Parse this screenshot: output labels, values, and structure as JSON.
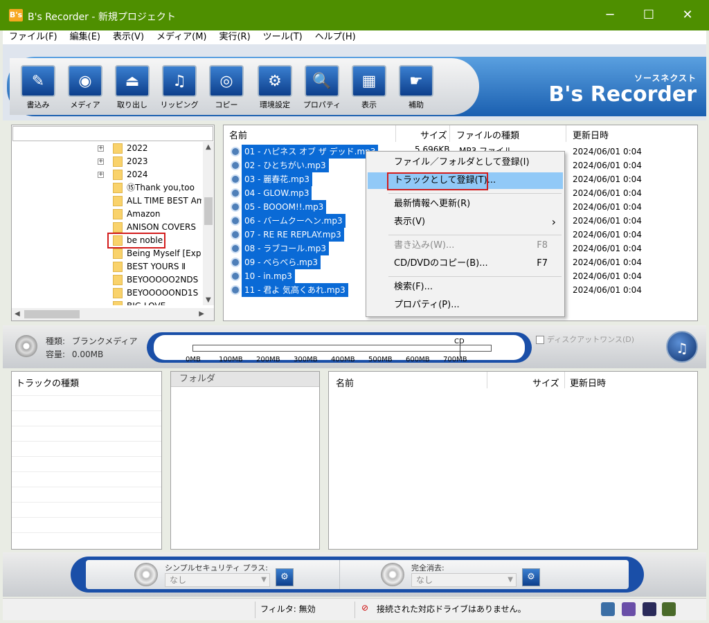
{
  "window": {
    "app_icon_text": "B's",
    "title": "B's Recorder - 新規プロジェクト",
    "minimize": "─",
    "maximize": "☐",
    "close": "✕"
  },
  "menu": [
    "ファイル(F)",
    "編集(E)",
    "表示(V)",
    "メディア(M)",
    "実行(R)",
    "ツール(T)",
    "ヘルプ(H)"
  ],
  "toolbar": {
    "buttons": [
      {
        "label": "書込み",
        "icon": "pencil-icon",
        "glyph": "✎"
      },
      {
        "label": "メディア",
        "icon": "disc-icon",
        "glyph": "◉"
      },
      {
        "label": "取り出し",
        "icon": "eject-icon",
        "glyph": "⏏"
      },
      {
        "label": "リッピング",
        "icon": "rip-icon",
        "glyph": "♫"
      },
      {
        "label": "コピー",
        "icon": "copy-disc-icon",
        "glyph": "◎"
      },
      {
        "label": "環境設定",
        "icon": "settings-icon",
        "glyph": "⚙"
      },
      {
        "label": "プロパティ",
        "icon": "properties-icon",
        "glyph": "🔍"
      },
      {
        "label": "表示",
        "icon": "view-icon",
        "glyph": "▦"
      },
      {
        "label": "補助",
        "icon": "hand-icon",
        "glyph": "☛"
      }
    ],
    "brand_sub": "ソースネクスト",
    "brand_name": "B's Recorder"
  },
  "tree": {
    "items": [
      {
        "label": "2022",
        "expander": "+"
      },
      {
        "label": "2023",
        "expander": "+"
      },
      {
        "label": "2024",
        "expander": "+"
      },
      {
        "label": "⑮Thank you,too",
        "expander": ""
      },
      {
        "label": "ALL TIME BEST Ambi",
        "expander": ""
      },
      {
        "label": "Amazon",
        "expander": ""
      },
      {
        "label": "ANISON COVERS",
        "expander": ""
      },
      {
        "label": "be noble",
        "expander": ""
      },
      {
        "label": "Being Myself [Exp",
        "expander": ""
      },
      {
        "label": "BEST YOURS Ⅱ",
        "expander": ""
      },
      {
        "label": "BEYOOOOO2NDS",
        "expander": ""
      },
      {
        "label": "BEYOOOOOND1S",
        "expander": ""
      },
      {
        "label": "BIG LOVE",
        "expander": ""
      }
    ]
  },
  "files": {
    "headers": {
      "name": "名前",
      "size": "サイズ",
      "type": "ファイルの種類",
      "date": "更新日時"
    },
    "first_size": "5,696KB",
    "first_type": "MP3 ファイル",
    "rows": [
      {
        "name": "01 - ハピネス オブ ザ デッド.mp3",
        "date": "2024/06/01 0:04"
      },
      {
        "name": "02 - ひとちがい.mp3",
        "date": "2024/06/01 0:04"
      },
      {
        "name": "03 - 麗春花.mp3",
        "date": "2024/06/01 0:04"
      },
      {
        "name": "04 - GLOW.mp3",
        "date": "2024/06/01 0:04"
      },
      {
        "name": "05 - BOOOM!!.mp3",
        "date": "2024/06/01 0:04"
      },
      {
        "name": "06 - バームクーヘン.mp3",
        "date": "2024/06/01 0:04"
      },
      {
        "name": "07 - RE RE REPLAY.mp3",
        "date": "2024/06/01 0:04"
      },
      {
        "name": "08 - ラブコール.mp3",
        "date": "2024/06/01 0:04"
      },
      {
        "name": "09 - べらべら.mp3",
        "date": "2024/06/01 0:04"
      },
      {
        "name": "10 - in.mp3",
        "date": "2024/06/01 0:04"
      },
      {
        "name": "11 - 君よ 気高くあれ.mp3",
        "date": "2024/06/01 0:04"
      }
    ]
  },
  "context_menu": {
    "register_file_folder": "ファイル／フォルダとして登録(I)",
    "register_track": "トラックとして登録(T)...",
    "refresh": "最新情報へ更新(R)",
    "view": "表示(V)",
    "view_arrow": "›",
    "write": "書き込み(W)...",
    "write_key": "F8",
    "copy": "CD/DVDのコピー(B)...",
    "copy_key": "F7",
    "search": "検索(F)...",
    "properties": "プロパティ(P)..."
  },
  "media": {
    "type_label": "種類:",
    "type_value": "ブランクメディア",
    "capacity_label": "容量:",
    "capacity_value": "0.00MB",
    "ticks": [
      "0MB",
      "100MB",
      "200MB",
      "300MB",
      "400MB",
      "500MB",
      "600MB",
      "700MB"
    ],
    "cd_label": "CD",
    "disc_at_once": "ディスクアットワンス(D)"
  },
  "bottom": {
    "track_type_header": "トラックの種類",
    "folder_header": "フォルダ",
    "name_header": "名前",
    "size_header": "サイズ",
    "date_header": "更新日時"
  },
  "security": {
    "simple_label": "シンプルセキュリティ プラス:",
    "simple_value": "なし",
    "erase_label": "完全消去:",
    "erase_value": "なし"
  },
  "status": {
    "filter": "フィルタ: 無効",
    "drive": "接続された対応ドライブはありません。"
  },
  "colors": {
    "titlebar": "#4e8f00",
    "selection": "#0a6ad6",
    "highlight": "#91c9f7",
    "accent_blue": "#1a4fa8",
    "red_box": "#d21b1b"
  }
}
